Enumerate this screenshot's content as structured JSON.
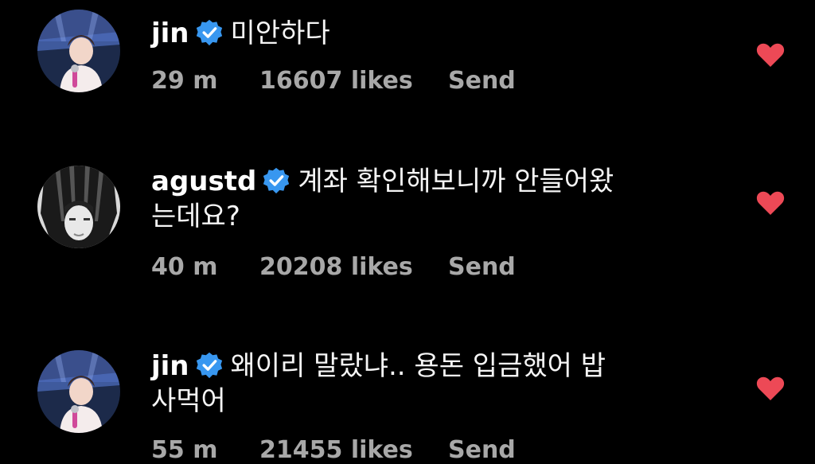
{
  "comments": [
    {
      "username": "jin",
      "text": "미안하다",
      "time": "29 m",
      "likes": "16607 likes",
      "action": "Send",
      "liked": true
    },
    {
      "username": "agustd",
      "text": "계좌 확인해보니까 안들어왔는데요?",
      "time": "40 m",
      "likes": "20208 likes",
      "action": "Send",
      "liked": true
    },
    {
      "username": "jin",
      "text": "왜이리 말랐냐.. 용돈 입금했어 밥사먹어",
      "time": "55 m",
      "likes": "21455 likes",
      "action": "Send",
      "liked": true
    }
  ],
  "colors": {
    "background": "#000000",
    "verified": "#3897f0",
    "heart": "#ed4956",
    "meta": "#a8a8a8"
  },
  "icons": {
    "verified": "verified-badge-icon",
    "heart": "heart-filled-icon"
  }
}
